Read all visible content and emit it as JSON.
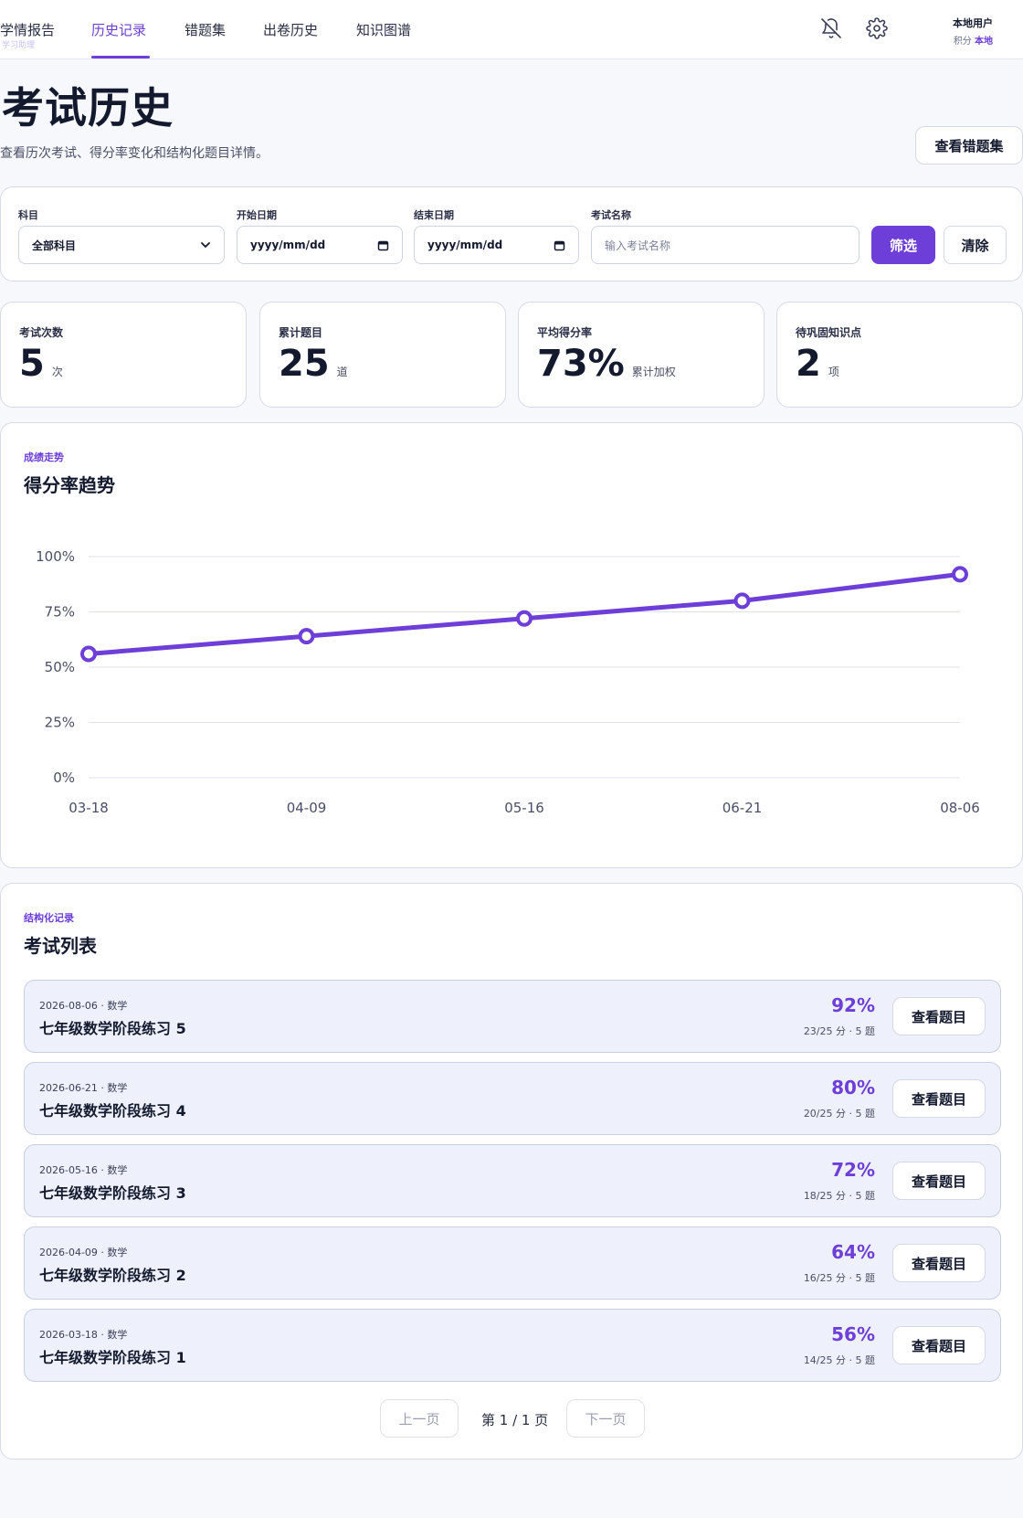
{
  "nav": {
    "items": [
      {
        "label": "学情报告",
        "active": false
      },
      {
        "label": "历史记录",
        "active": true
      },
      {
        "label": "错题集",
        "active": false
      },
      {
        "label": "出卷历史",
        "active": false
      },
      {
        "label": "知识图谱",
        "active": false
      }
    ],
    "ghost_label": "学习助理"
  },
  "user": {
    "name": "本地用户",
    "points_label": "积分",
    "points_value": "本地"
  },
  "header": {
    "title": "考试历史",
    "subtitle": "查看历次考试、得分率变化和结构化题目详情。",
    "wrongbook_button": "查看错题集"
  },
  "filters": {
    "subject_label": "科目",
    "subject_value": "全部科目",
    "start_label": "开始日期",
    "start_value": "yyyy/mm/dd",
    "end_label": "结束日期",
    "end_value": "yyyy/mm/dd",
    "name_label": "考试名称",
    "name_placeholder": "输入考试名称",
    "filter_button": "筛选",
    "clear_button": "清除"
  },
  "stats": [
    {
      "label": "考试次数",
      "value": "5",
      "unit": "次"
    },
    {
      "label": "累计题目",
      "value": "25",
      "unit": "道"
    },
    {
      "label": "平均得分率",
      "value": "73%",
      "unit": "累计加权"
    },
    {
      "label": "待巩固知识点",
      "value": "2",
      "unit": "项"
    }
  ],
  "trend": {
    "kicker": "成绩走势",
    "title": "得分率趋势"
  },
  "chart_data": {
    "type": "line",
    "categories": [
      "03-18",
      "04-09",
      "05-16",
      "06-21",
      "08-06"
    ],
    "series": [
      {
        "values": [
          56,
          64,
          72,
          80,
          92
        ]
      }
    ],
    "ylim": [
      0,
      100
    ],
    "yticks": [
      "0%",
      "25%",
      "50%",
      "75%",
      "100%"
    ],
    "grid": true,
    "color": "#6d3fd8"
  },
  "list": {
    "kicker": "结构化记录",
    "title": "考试列表",
    "view_button": "查看题目",
    "exams": [
      {
        "meta": "2026-08-06 · 数学",
        "name": "七年级数学阶段练习 5",
        "rate": "92%",
        "score": "23/25 分 · 5 题"
      },
      {
        "meta": "2026-06-21 · 数学",
        "name": "七年级数学阶段练习 4",
        "rate": "80%",
        "score": "20/25 分 · 5 题"
      },
      {
        "meta": "2026-05-16 · 数学",
        "name": "七年级数学阶段练习 3",
        "rate": "72%",
        "score": "18/25 分 · 5 题"
      },
      {
        "meta": "2026-04-09 · 数学",
        "name": "七年级数学阶段练习 2",
        "rate": "64%",
        "score": "16/25 分 · 5 题"
      },
      {
        "meta": "2026-03-18 · 数学",
        "name": "七年级数学阶段练习 1",
        "rate": "56%",
        "score": "14/25 分 · 5 题"
      }
    ]
  },
  "pager": {
    "prev": "上一页",
    "info": "第 1 / 1 页",
    "next": "下一页"
  },
  "icons": {
    "bell": "bell-off-icon",
    "settings": "gear-icon",
    "select": "chevron-down-icon",
    "date": "calendar-icon"
  }
}
